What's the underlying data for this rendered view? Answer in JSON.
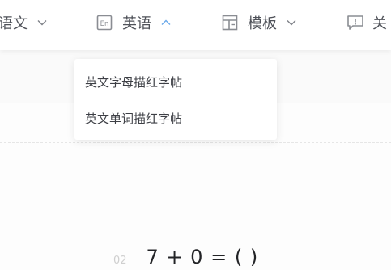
{
  "nav": {
    "items": [
      {
        "label": "语文",
        "icon": "",
        "chevron": "down"
      },
      {
        "label": "英语",
        "icon": "en-book-icon",
        "chevron": "up"
      },
      {
        "label": "模板",
        "icon": "template-icon",
        "chevron": "down"
      },
      {
        "label": "关",
        "icon": "feedback-icon",
        "chevron": ""
      }
    ]
  },
  "dropdown": {
    "items": [
      "英文字母描红字帖",
      "英文单词描红字帖"
    ]
  },
  "worksheet": {
    "question_number": "02",
    "equation": "7 + 0 = (    )"
  },
  "colors": {
    "nav_text": "#4f5259",
    "icon_gray": "#8a8d93",
    "active_chevron": "#6aa9ea",
    "chevron_gray": "#7d8087",
    "dropdown_text": "#3d3f45",
    "equation_text": "#222326",
    "faint_number": "#cfcfcf"
  }
}
